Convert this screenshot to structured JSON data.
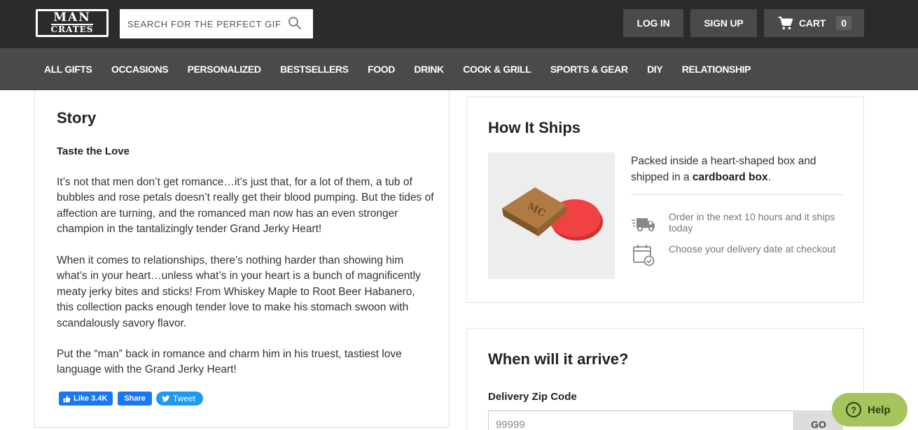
{
  "header": {
    "logo": {
      "line1": "MAN",
      "line2": "CRATES"
    },
    "search": {
      "placeholder": "SEARCH FOR THE PERFECT GIFT"
    },
    "login_label": "LOG IN",
    "signup_label": "SIGN UP",
    "cart": {
      "label": "CART",
      "count": "0"
    }
  },
  "nav": {
    "items": [
      "ALL GIFTS",
      "OCCASIONS",
      "PERSONALIZED",
      "BESTSELLERS",
      "FOOD",
      "DRINK",
      "COOK & GRILL",
      "SPORTS & GEAR",
      "DIY",
      "RELATIONSHIP"
    ]
  },
  "story": {
    "title": "Story",
    "subtitle": "Taste the Love",
    "paragraphs": [
      "It’s not that men don’t get romance…it’s just that, for a lot of them, a tub of bubbles and rose petals doesn’t really get their blood pumping. But the tides of affection are turning, and the romanced man now has an even stronger champion in the tantalizingly tender Grand Jerky Heart!",
      "When it comes to relationships, there’s nothing harder than showing him what’s in your heart…unless what’s in your heart is a bunch of magnificently meaty jerky bites and sticks! From Whiskey Maple to Root Beer Habanero, this collection packs enough tender love to make his stomach swoon with scandalously savory flavor.",
      "Put the “man” back in romance and charm him in his truest, tastiest love language with the Grand Jerky Heart!"
    ],
    "social": {
      "like_label": "Like 3.4K",
      "share_label": "Share",
      "tweet_label": "Tweet"
    }
  },
  "ships": {
    "title": "How It Ships",
    "image_label": "MC",
    "desc_prefix": "Packed inside a heart-shaped box and shipped in a ",
    "desc_bold": "cardboard box",
    "desc_suffix": ".",
    "order_text": "Order in the next 10 hours and it ships today",
    "delivery_text": "Choose your delivery date at checkout"
  },
  "arrive": {
    "title": "When will it arrive?",
    "zip_label": "Delivery Zip Code",
    "zip_placeholder": "99999",
    "go_label": "GO"
  },
  "help": {
    "label": "Help",
    "icon_glyph": "?"
  },
  "colors": {
    "topbar": "#2b2b2b",
    "navbar": "#4a4a4a",
    "facebook": "#1877f2",
    "twitter": "#1d9bf0",
    "help": "#a6c45e",
    "heart_box": "#f04242"
  }
}
